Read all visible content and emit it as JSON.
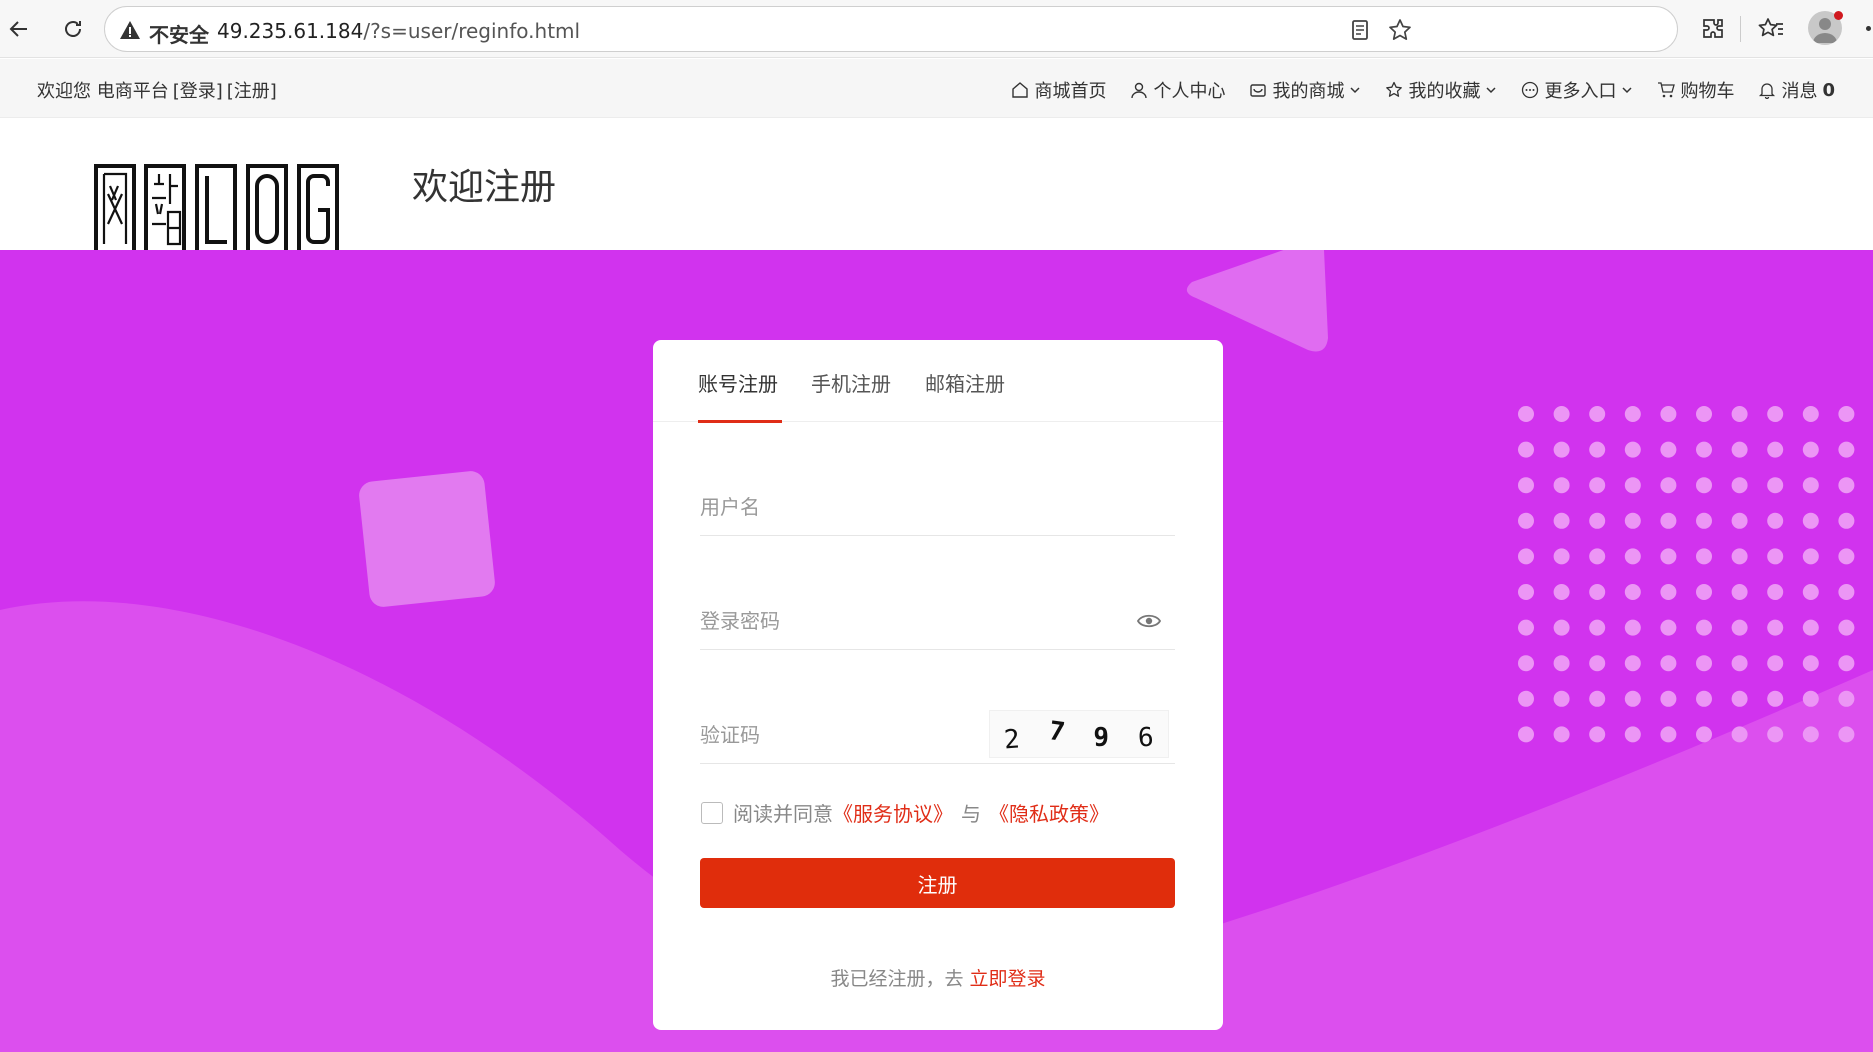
{
  "browser": {
    "security_label": "不安全",
    "url_host": "49.235.61.184",
    "url_path": "/?s=user/reginfo.html"
  },
  "topbar": {
    "welcome": "欢迎您 电商平台",
    "login_link": "[登录]",
    "register_link": "[注册]",
    "menu": [
      {
        "label": "商城首页",
        "icon": "home-icon"
      },
      {
        "label": "个人中心",
        "icon": "user-icon"
      },
      {
        "label": "我的商城",
        "icon": "shop-icon",
        "dropdown": true
      },
      {
        "label": "我的收藏",
        "icon": "star-icon",
        "dropdown": true
      },
      {
        "label": "更多入口",
        "icon": "more-icon",
        "dropdown": true
      },
      {
        "label": "购物车",
        "icon": "cart-icon"
      },
      {
        "label": "消息",
        "icon": "bell-icon",
        "count": "0"
      }
    ]
  },
  "header": {
    "title": "欢迎注册"
  },
  "form": {
    "tabs": [
      {
        "label": "账号注册",
        "active": true
      },
      {
        "label": "手机注册",
        "active": false
      },
      {
        "label": "邮箱注册",
        "active": false
      }
    ],
    "username_placeholder": "用户名",
    "password_placeholder": "登录密码",
    "captcha_placeholder": "验证码",
    "captcha_digits": [
      "2",
      "7",
      "9",
      "6"
    ],
    "agree_text": "阅读并同意",
    "service_agreement": "《服务协议》",
    "agree_and": "与",
    "privacy_policy": "《隐私政策》",
    "submit_label": "注册",
    "login_tip": "我已经注册，去",
    "login_link": "立即登录"
  },
  "colors": {
    "hero_bg": "#d133ee",
    "accent": "#e02d17",
    "submit_bg": "#e02d0c"
  }
}
